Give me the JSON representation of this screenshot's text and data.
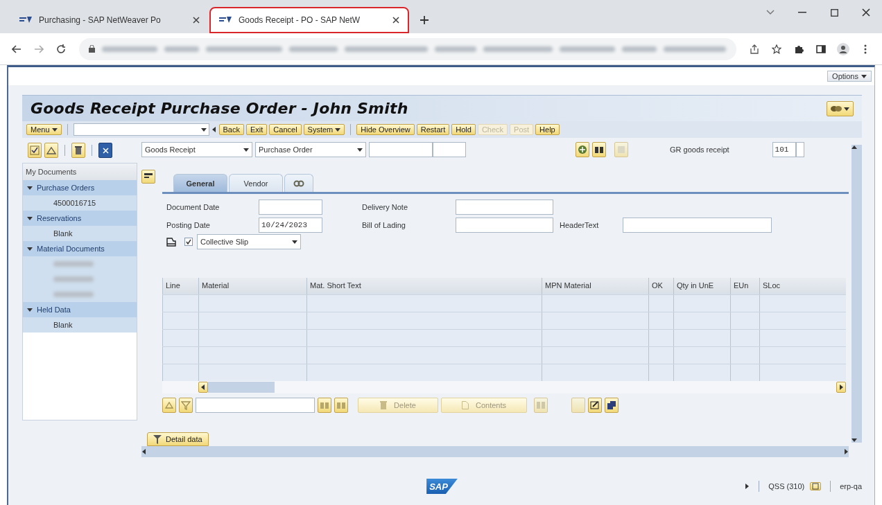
{
  "browser": {
    "tabs": [
      {
        "title": "Purchasing - SAP NetWeaver Po",
        "selected": false,
        "highlighted": false
      },
      {
        "title": "Goods Receipt - PO - SAP NetW",
        "selected": true,
        "highlighted": true
      }
    ]
  },
  "sap": {
    "options": "Options",
    "title": "Goods Receipt Purchase Order - John Smith",
    "menu": {
      "label": "Menu"
    },
    "nav_buttons": [
      {
        "label": "Back",
        "disabled": false,
        "dropdown": false
      },
      {
        "label": "Exit",
        "disabled": false,
        "dropdown": false
      },
      {
        "label": "Cancel",
        "disabled": false,
        "dropdown": false
      },
      {
        "label": "System",
        "disabled": false,
        "dropdown": true
      }
    ],
    "action_buttons": [
      {
        "label": "Hide Overview",
        "disabled": false,
        "dropdown": false
      },
      {
        "label": "Restart",
        "disabled": false,
        "dropdown": false
      },
      {
        "label": "Hold",
        "disabled": false,
        "dropdown": false
      },
      {
        "label": "Check",
        "disabled": true,
        "dropdown": false
      },
      {
        "label": "Post",
        "disabled": true,
        "dropdown": false
      },
      {
        "label": "Help",
        "disabled": false,
        "dropdown": false
      }
    ],
    "sidebar": {
      "header": "My Documents",
      "groups": [
        {
          "label": "Purchase Orders",
          "expanded": true,
          "children": [
            {
              "kind": "text",
              "label": "4500016715"
            }
          ]
        },
        {
          "label": "Reservations",
          "expanded": true,
          "children": [
            {
              "kind": "text",
              "label": "Blank"
            }
          ]
        },
        {
          "label": "Material Documents",
          "expanded": true,
          "children": [
            {
              "kind": "redacted"
            },
            {
              "kind": "redacted"
            },
            {
              "kind": "redacted"
            }
          ]
        },
        {
          "label": "Held Data",
          "expanded": true,
          "children": [
            {
              "kind": "text",
              "label": "Blank"
            }
          ]
        }
      ]
    },
    "transaction": "Goods Receipt",
    "reference": "Purchase Order",
    "movement_label": "GR goods receipt",
    "movement_type": "101",
    "tabs": [
      {
        "kind": "text",
        "label": "General",
        "selected": true
      },
      {
        "kind": "text",
        "label": "Vendor",
        "selected": false
      },
      {
        "kind": "icon",
        "selected": false
      }
    ],
    "fields": [
      {
        "label": "Document Date"
      },
      {
        "label": "Posting Date",
        "value": "10/24/2023"
      },
      {
        "label": "Delivery Note"
      },
      {
        "label": "Bill of Lading"
      },
      {
        "label": "HeaderText"
      }
    ],
    "print": {
      "checked": true,
      "value": "Collective Slip"
    },
    "table": {
      "columns": [
        "Line",
        "Material",
        "Mat. Short Text",
        "MPN Material",
        "OK",
        "Qty in UnE",
        "EUn",
        "SLoc"
      ]
    },
    "item_buttons": [
      {
        "label": "Delete"
      },
      {
        "label": "Contents"
      }
    ],
    "detail_tab": "Detail data",
    "status": {
      "logo": "SAP",
      "system": "QSS (310)",
      "server": "erp-qa"
    }
  }
}
